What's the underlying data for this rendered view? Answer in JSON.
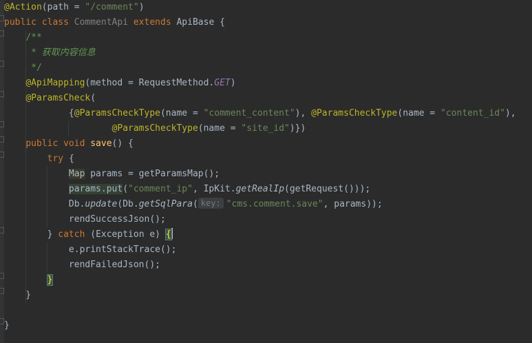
{
  "editor": {
    "lines": [
      [
        {
          "t": "@Action",
          "c": "ann"
        },
        {
          "t": "(path = ",
          "c": "plain"
        },
        {
          "t": "\"/comment\"",
          "c": "str"
        },
        {
          "t": ")",
          "c": "plain"
        }
      ],
      [
        {
          "t": "public class ",
          "c": "kw"
        },
        {
          "t": "CommentApi",
          "c": "cls-unused"
        },
        {
          "t": " extends ",
          "c": "kw"
        },
        {
          "t": "ApiBase {",
          "c": "plain"
        }
      ],
      [
        {
          "t": "    ",
          "c": "plain"
        },
        {
          "t": "/**",
          "c": "doc"
        }
      ],
      [
        {
          "t": "     ",
          "c": "plain"
        },
        {
          "t": "* 获取内容信息",
          "c": "doc-italic"
        }
      ],
      [
        {
          "t": "     ",
          "c": "plain"
        },
        {
          "t": "*/",
          "c": "doc"
        }
      ],
      [
        {
          "t": "    ",
          "c": "plain"
        },
        {
          "t": "@ApiMapping",
          "c": "ann"
        },
        {
          "t": "(method = RequestMethod.",
          "c": "plain"
        },
        {
          "t": "GET",
          "c": "field"
        },
        {
          "t": ")",
          "c": "plain"
        }
      ],
      [
        {
          "t": "    ",
          "c": "plain"
        },
        {
          "t": "@ParamsCheck",
          "c": "ann"
        },
        {
          "t": "(",
          "c": "plain"
        }
      ],
      [
        {
          "t": "            {",
          "c": "plain"
        },
        {
          "t": "@ParamsCheckType",
          "c": "ann"
        },
        {
          "t": "(name = ",
          "c": "plain"
        },
        {
          "t": "\"comment_content\"",
          "c": "str"
        },
        {
          "t": "), ",
          "c": "plain"
        },
        {
          "t": "@ParamsCheckType",
          "c": "ann"
        },
        {
          "t": "(name = ",
          "c": "plain"
        },
        {
          "t": "\"content_id\"",
          "c": "str"
        },
        {
          "t": "),",
          "c": "plain"
        }
      ],
      [
        {
          "t": "                    ",
          "c": "plain"
        },
        {
          "t": "@ParamsCheckType",
          "c": "ann"
        },
        {
          "t": "(name = ",
          "c": "plain"
        },
        {
          "t": "\"site_id\"",
          "c": "str"
        },
        {
          "t": ")})",
          "c": "plain"
        }
      ],
      [
        {
          "t": "    ",
          "c": "plain"
        },
        {
          "t": "public void ",
          "c": "kw"
        },
        {
          "t": "save",
          "c": "fn"
        },
        {
          "t": "() {",
          "c": "plain"
        }
      ],
      [
        {
          "t": "        ",
          "c": "plain"
        },
        {
          "t": "try ",
          "c": "kw"
        },
        {
          "t": "{",
          "c": "plain"
        }
      ],
      [
        {
          "t": "            ",
          "c": "plain"
        },
        {
          "t": "Map",
          "c": "hl-type"
        },
        {
          "t": " params = getParamsMap();",
          "c": "plain"
        }
      ],
      [
        {
          "t": "            ",
          "c": "plain"
        },
        {
          "t": "params.put",
          "c": "hl-id"
        },
        {
          "t": "(",
          "c": "plain"
        },
        {
          "t": "\"comment_ip\"",
          "c": "str"
        },
        {
          "t": ", IpKit.",
          "c": "plain"
        },
        {
          "t": "getRealIp",
          "c": "italic"
        },
        {
          "t": "(getRequest()));",
          "c": "plain"
        }
      ],
      [
        {
          "t": "            Db.",
          "c": "plain"
        },
        {
          "t": "update",
          "c": "italic"
        },
        {
          "t": "(Db.",
          "c": "plain"
        },
        {
          "t": "getSqlPara",
          "c": "italic"
        },
        {
          "t": "(",
          "c": "plain"
        },
        {
          "t": "key:",
          "c": "hint"
        },
        {
          "t": "\"cms.comment.save\"",
          "c": "str"
        },
        {
          "t": ", params));",
          "c": "plain"
        }
      ],
      [
        {
          "t": "            rendSuccessJson();",
          "c": "plain"
        }
      ],
      [
        {
          "t": "        } ",
          "c": "plain"
        },
        {
          "t": "catch ",
          "c": "kw"
        },
        {
          "t": "(Exception e) ",
          "c": "plain"
        },
        {
          "t": "{",
          "c": "brace-match"
        },
        {
          "t": "",
          "c": "caret"
        }
      ],
      [
        {
          "t": "            e.printStackTrace();",
          "c": "plain"
        }
      ],
      [
        {
          "t": "            rendFailedJson();",
          "c": "plain"
        }
      ],
      [
        {
          "t": "        ",
          "c": "plain"
        },
        {
          "t": "}",
          "c": "brace-match"
        }
      ],
      [
        {
          "t": "    }",
          "c": "plain"
        }
      ],
      [
        {
          "t": "",
          "c": "plain"
        }
      ],
      [
        {
          "t": "}",
          "c": "plain"
        }
      ]
    ]
  }
}
